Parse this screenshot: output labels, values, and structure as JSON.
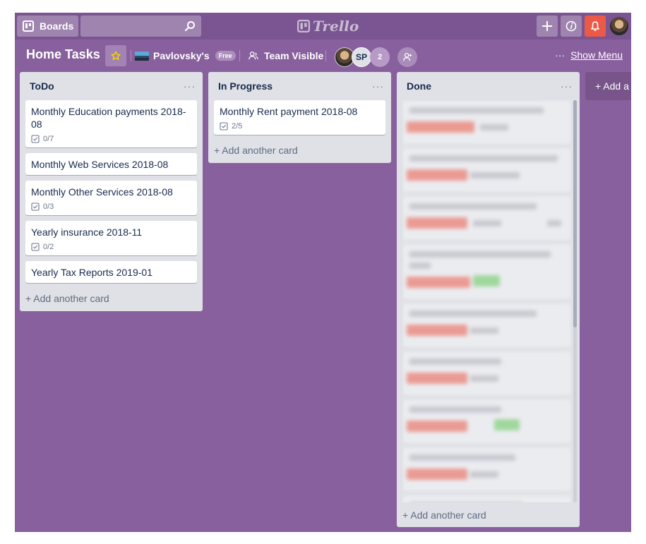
{
  "header": {
    "boards_label": "Boards",
    "search_placeholder": "",
    "logo_text": "Trello",
    "bell_color": "#eb5a46"
  },
  "board": {
    "title": "Home Tasks",
    "team_name": "Pavlovsky's",
    "team_badge": "Free",
    "visibility": "Team Visible",
    "member_initials": "SP",
    "member_more": "2",
    "menu_label": "Show Menu",
    "menu_dots": "···",
    "background_color": "#89609e"
  },
  "lists": [
    {
      "title": "ToDo",
      "cards": [
        {
          "title": "Monthly Education payments 2018-08",
          "checklist": "0/7"
        },
        {
          "title": "Monthly Web Services 2018-08"
        },
        {
          "title": "Monthly Other Services 2018-08",
          "checklist": "0/3"
        },
        {
          "title": "Yearly insurance 2018-11",
          "checklist": "0/2"
        },
        {
          "title": "Yearly Tax Reports 2019-01"
        }
      ],
      "add_label": "+ Add another card"
    },
    {
      "title": "In Progress",
      "cards": [
        {
          "title": "Monthly Rent payment 2018-08",
          "checklist": "2/5"
        }
      ],
      "add_label": "+ Add another card"
    },
    {
      "title": "Done",
      "add_label": "+ Add another card"
    }
  ],
  "list_menu_dots": "···",
  "add_list_label": "+ Add a"
}
